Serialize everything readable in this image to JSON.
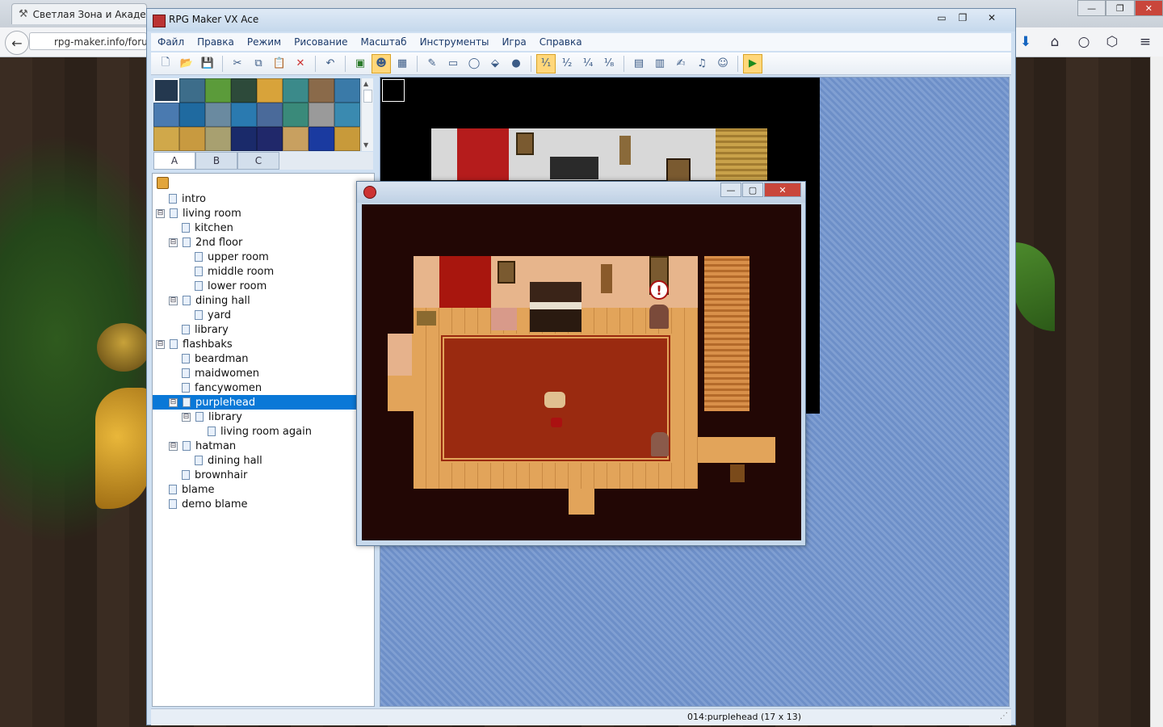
{
  "browser": {
    "tab_title": "Светлая Зона и Академия",
    "url": "rpg-maker.info/forum",
    "window_controls": [
      "—",
      "❐",
      "✕"
    ]
  },
  "rm": {
    "title": "RPG Maker VX Ace",
    "menus": [
      "Файл",
      "Правка",
      "Режим",
      "Рисование",
      "Масштаб",
      "Инструменты",
      "Игра",
      "Справка"
    ],
    "tileset_tabs": [
      "A",
      "B",
      "C"
    ],
    "status": "014:purplehead (17 x 13)",
    "window_controls": [
      "▭",
      "❐",
      "✕"
    ]
  },
  "tree": [
    {
      "label": "intro"
    },
    {
      "label": "living room",
      "exp": "⊟"
    },
    {
      "label": "kitchen"
    },
    {
      "label": "2nd floor",
      "exp": "⊟"
    },
    {
      "label": "upper room"
    },
    {
      "label": "middle room"
    },
    {
      "label": "lower room"
    },
    {
      "label": "dining hall",
      "exp": "⊟"
    },
    {
      "label": "yard"
    },
    {
      "label": "library"
    },
    {
      "label": "flashbaks",
      "exp": "⊟"
    },
    {
      "label": "beardman"
    },
    {
      "label": "maidwomen"
    },
    {
      "label": "fancywomen"
    },
    {
      "label": "purplehead",
      "exp": "⊟"
    },
    {
      "label": "library",
      "exp": "⊟"
    },
    {
      "label": "living room again"
    },
    {
      "label": "hatman",
      "exp": "⊟"
    },
    {
      "label": "dining hall"
    },
    {
      "label": "brownhair"
    },
    {
      "label": "blame"
    },
    {
      "label": "demo blame"
    }
  ],
  "playtest": {
    "window_controls": [
      "—",
      "▢",
      "✕"
    ]
  },
  "colors": {
    "selection": "#0a78d7",
    "map_bg": "#6d8fc8",
    "game_bg": "#220705",
    "carpet": "#9a2a10",
    "floor": "#e2a45a"
  }
}
